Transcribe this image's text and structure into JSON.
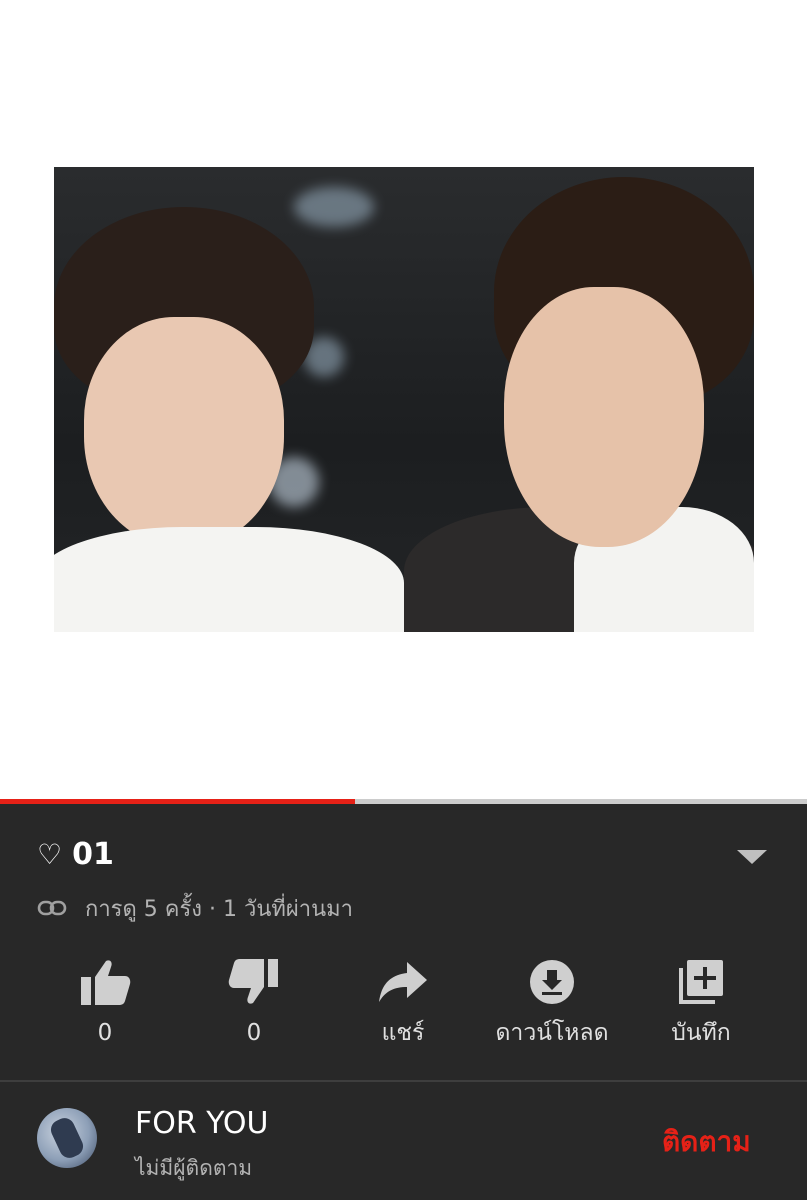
{
  "video": {
    "progress": 0.44
  },
  "info": {
    "title_icon": "heart-outline-icon",
    "heart_glyph": "♡",
    "title": "01",
    "meta": "การดู 5 ครั้ง · 1 วันที่ผ่านมา"
  },
  "actions": [
    {
      "icon": "thumbs-up-icon",
      "label": "0"
    },
    {
      "icon": "thumbs-down-icon",
      "label": "0"
    },
    {
      "icon": "share-icon",
      "label": "แชร์"
    },
    {
      "icon": "download-icon",
      "label": "ดาวน์โหลด"
    },
    {
      "icon": "add-to-playlist-icon",
      "label": "บันทึก"
    }
  ],
  "channel": {
    "name": "FOR YOU",
    "subscribers": "ไม่มีผู้ติดตาม",
    "subscribe_label": "ติดตาม"
  },
  "colors": {
    "accent": "#e62117",
    "panel_bg": "#282828",
    "text_primary": "#ffffff",
    "text_secondary": "#b3b3b3"
  }
}
